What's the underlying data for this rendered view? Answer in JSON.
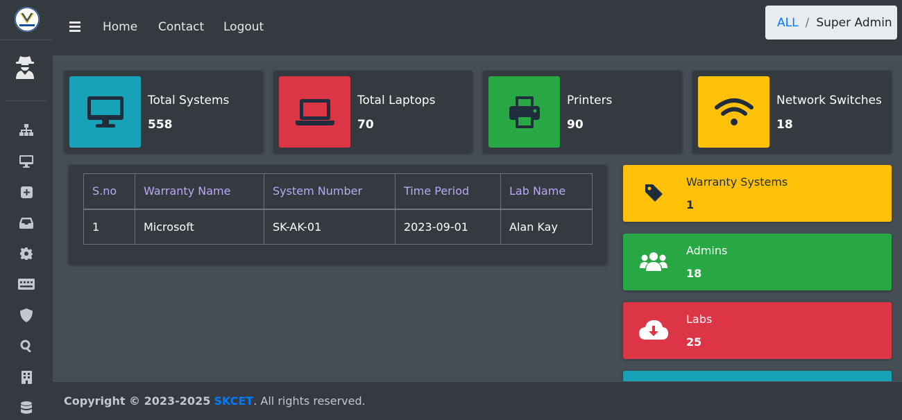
{
  "nav": {
    "home": "Home",
    "contact": "Contact",
    "logout": "Logout"
  },
  "breadcrumb": {
    "root": "ALL",
    "separator": "/",
    "current": "Super Admin"
  },
  "sidebar": {
    "icons": [
      "sitemap-icon",
      "desktop-icon",
      "plus-square-icon",
      "inbox-icon",
      "gear-icon",
      "keyboard-icon",
      "shield-icon",
      "search-icon",
      "building-icon",
      "database-icon"
    ]
  },
  "info_boxes": [
    {
      "label": "Total Systems",
      "value": "558",
      "color": "#17a2b8",
      "icon": "desktop-icon"
    },
    {
      "label": "Total Laptops",
      "value": "70",
      "color": "#dc3545",
      "icon": "laptop-icon"
    },
    {
      "label": "Printers",
      "value": "90",
      "color": "#28a745",
      "icon": "printer-icon"
    },
    {
      "label": "Network Switches",
      "value": "18",
      "color": "#ffc107",
      "icon": "wifi-icon"
    }
  ],
  "table": {
    "headers": [
      "S.no",
      "Warranty Name",
      "System Number",
      "Time Period",
      "Lab Name"
    ],
    "rows": [
      [
        "1",
        "Microsoft",
        "SK-AK-01",
        "2023-09-01",
        "Alan Kay"
      ]
    ]
  },
  "small_boxes": [
    {
      "label": "Warranty Systems",
      "value": "1",
      "color": "#ffc107",
      "icon": "tag-icon"
    },
    {
      "label": "Admins",
      "value": "18",
      "color": "#28a745",
      "icon": "users-icon"
    },
    {
      "label": "Labs",
      "value": "25",
      "color": "#dc3545",
      "icon": "cloud-download-icon"
    }
  ],
  "footer": {
    "prefix": "Copyright © 2023-2025",
    "brand": "SKCET",
    "suffix": ". All rights reserved."
  }
}
